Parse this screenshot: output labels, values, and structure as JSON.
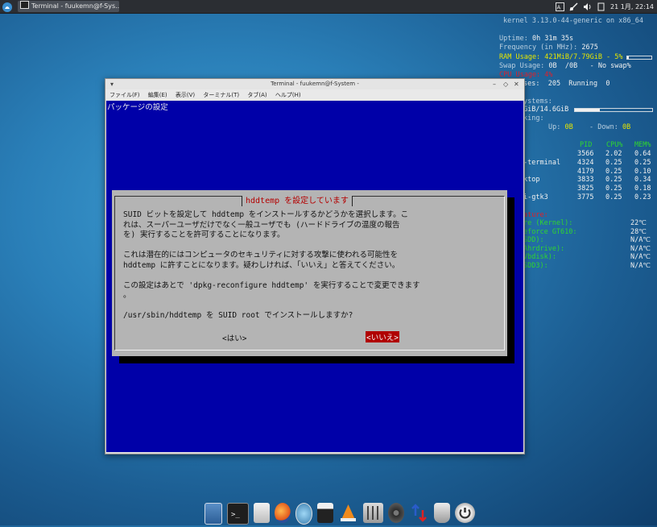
{
  "top_panel": {
    "task_title": "Terminal - fuukemn@f-Sys...",
    "clock": "21 1月, 22:14"
  },
  "conky": {
    "kernel": "kernel 3.13.0-44-generic on x86_64",
    "uptime_label": "Uptime:",
    "uptime_value": "0h 31m 35s",
    "freq_label": "Frequency (in MHz):",
    "freq_value": "2675",
    "ram_text": "RAM Usage: 421MiB/7.79GiB - 5%",
    "ram_fraction": 0.05,
    "swap_label": "Swap Usage:",
    "swap_value": "0B  /0B   - No swap%",
    "cpu_usage_red": "CPU Usage: 4%",
    "processes": "ses:  205  Running  0",
    "filesystems_label": "ystems:",
    "fs_value": "GiB/14.6GiB",
    "fs_fraction": 0.32,
    "networking_label": "king:",
    "net_up_label": "Up:",
    "net_up_value": "0B",
    "net_down_label": "- Down:",
    "net_down_value": "0B",
    "proc_headers": [
      "PID",
      "CPU%",
      "MEM%"
    ],
    "proc_rows": [
      {
        "name": "",
        "pid": "3566",
        "cpu": "2.02",
        "mem": "0.64"
      },
      {
        "name": "-terminal",
        "pid": "4324",
        "cpu": "0.25",
        "mem": "0.25"
      },
      {
        "name": "",
        "pid": "4179",
        "cpu": "0.25",
        "mem": "0.10"
      },
      {
        "name": "ktop",
        "pid": "3833",
        "cpu": "0.25",
        "mem": "0.34"
      },
      {
        "name": "",
        "pid": "3825",
        "cpu": "0.25",
        "mem": "0.18"
      },
      {
        "name": "i-gtk3",
        "pid": "3775",
        "cpu": "0.25",
        "mem": "0.23"
      }
    ],
    "temps_header": "ature:",
    "temps": [
      {
        "name": "re (Kernel):",
        "value": "22℃"
      },
      {
        "name": "eforce GT610:",
        "value": "28℃"
      },
      {
        "name": "SDD):",
        "value": "N/A℃"
      },
      {
        "name": "Ahrdrive):",
        "value": "N/A℃"
      },
      {
        "name": "Vbdisk):",
        "value": "N/A℃"
      },
      {
        "name": "SDD3):",
        "value": "N/A℃"
      }
    ]
  },
  "terminal": {
    "title": "Terminal - fuukemn@f-System -",
    "menu": [
      "ファイル(F)",
      "編集(E)",
      "表示(V)",
      "ターミナル(T)",
      "タブ(A)",
      "ヘルプ(H)"
    ],
    "header": "パッケージの設定",
    "dialog": {
      "title": "hddtemp を設定しています",
      "lines": [
        "SUID ビットを設定して hddtemp をインストールするかどうかを選択します。こ",
        "れは、スーパーユーザだけでなく一般ユーザでも (ハードドライブの温度の報告",
        "を) 実行することを許可することになります。",
        "",
        "これは潜在的にはコンピュータのセキュリティに対する攻撃に使われる可能性を",
        "hddtemp に許すことになります。疑わしければ、「いいえ」と答えてください。",
        "",
        "この設定はあとで 'dpkg-reconfigure hddtemp' を実行することで変更できます",
        "。",
        "",
        "/usr/sbin/hddtemp を SUID root でインストールしますか?"
      ],
      "yes_label": "<はい>",
      "no_label": "<いいえ>"
    }
  },
  "dock": {
    "icons": [
      "display-settings-icon",
      "terminal-icon",
      "text-editor-icon",
      "firefox-icon",
      "image-viewer-icon",
      "video-clapper-icon",
      "media-player-icon",
      "mixer-icon",
      "disk-utility-icon",
      "software-update-icon",
      "trash-icon",
      "logout-icon"
    ]
  }
}
